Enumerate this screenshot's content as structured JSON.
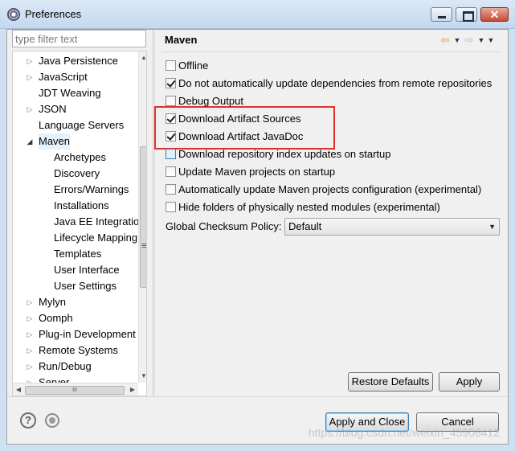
{
  "window": {
    "title": "Preferences",
    "close_glyph": "✕"
  },
  "filter": {
    "placeholder": "type filter text"
  },
  "tree": {
    "items": [
      {
        "label": "Java Persistence",
        "level": 0,
        "expander": "collapsed"
      },
      {
        "label": "JavaScript",
        "level": 0,
        "expander": "collapsed"
      },
      {
        "label": "JDT Weaving",
        "level": 0,
        "expander": "none"
      },
      {
        "label": "JSON",
        "level": 0,
        "expander": "collapsed"
      },
      {
        "label": "Language Servers",
        "level": 0,
        "expander": "none"
      },
      {
        "label": "Maven",
        "level": 0,
        "expander": "expanded",
        "selected": true
      },
      {
        "label": "Archetypes",
        "level": 1,
        "expander": "none"
      },
      {
        "label": "Discovery",
        "level": 1,
        "expander": "none"
      },
      {
        "label": "Errors/Warnings",
        "level": 1,
        "expander": "none"
      },
      {
        "label": "Installations",
        "level": 1,
        "expander": "none"
      },
      {
        "label": "Java EE Integration",
        "level": 1,
        "expander": "none"
      },
      {
        "label": "Lifecycle Mapping",
        "level": 1,
        "expander": "none"
      },
      {
        "label": "Templates",
        "level": 1,
        "expander": "none"
      },
      {
        "label": "User Interface",
        "level": 1,
        "expander": "none"
      },
      {
        "label": "User Settings",
        "level": 1,
        "expander": "none"
      },
      {
        "label": "Mylyn",
        "level": 0,
        "expander": "collapsed"
      },
      {
        "label": "Oomph",
        "level": 0,
        "expander": "collapsed"
      },
      {
        "label": "Plug-in Development",
        "level": 0,
        "expander": "collapsed"
      },
      {
        "label": "Remote Systems",
        "level": 0,
        "expander": "collapsed"
      },
      {
        "label": "Run/Debug",
        "level": 0,
        "expander": "collapsed"
      },
      {
        "label": "Server",
        "level": 0,
        "expander": "collapsed"
      }
    ],
    "hscroll_grip": "III",
    "vscroll_grip": "≡"
  },
  "page": {
    "title": "Maven",
    "nav": {
      "back": "⇦",
      "forward": "⇨",
      "dropdown": "▼"
    },
    "options": [
      {
        "label": "Offline",
        "checked": false
      },
      {
        "label": "Do not automatically update dependencies from remote repositories",
        "checked": true
      },
      {
        "label": "Debug Output",
        "checked": false
      },
      {
        "label": "Download Artifact Sources",
        "checked": true
      },
      {
        "label": "Download Artifact JavaDoc",
        "checked": true
      },
      {
        "label": "Download repository index updates on startup",
        "checked": false,
        "focused": true
      },
      {
        "label": "Update Maven projects on startup",
        "checked": false
      },
      {
        "label": "Automatically update Maven projects configuration (experimental)",
        "checked": false
      },
      {
        "label": "Hide folders of physically nested modules (experimental)",
        "checked": false
      }
    ],
    "checksum": {
      "label": "Global Checksum Policy:",
      "value": "Default"
    },
    "restore_defaults": "Restore Defaults",
    "apply": "Apply"
  },
  "footer": {
    "help_glyph": "?",
    "apply_and_close": "Apply and Close",
    "cancel": "Cancel"
  },
  "watermark": "https://blog.csdn.net/weixin_45906412",
  "colors": {
    "highlight": "#e0302d",
    "selection": "#e5f1fb"
  }
}
